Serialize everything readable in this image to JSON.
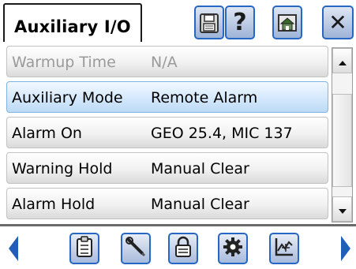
{
  "header": {
    "title": "Auxiliary I/O",
    "buttons": [
      {
        "icon": "save-icon"
      },
      {
        "icon": "help-icon",
        "glyph": "?"
      },
      {
        "icon": "home-icon"
      },
      {
        "icon": "close-icon",
        "glyph": "✕"
      }
    ]
  },
  "rows": [
    {
      "name": "Warmup Time",
      "value": "N/A",
      "state": "disabled"
    },
    {
      "name": "Auxiliary Mode",
      "value": "Remote Alarm",
      "state": "selected"
    },
    {
      "name": "Alarm On",
      "value": "GEO 25.4, MIC 137",
      "state": "normal"
    },
    {
      "name": "Warning Hold",
      "value": "Manual Clear",
      "state": "normal"
    },
    {
      "name": "Alarm Hold",
      "value": "Manual Clear",
      "state": "normal"
    }
  ],
  "scrollbar": {
    "up_icon": "arrow-up-icon",
    "down_icon": "arrow-down-icon"
  },
  "bottom_nav": {
    "left_icon": "chevron-left-icon",
    "right_icon": "chevron-right-icon",
    "buttons": [
      "clipboard-icon",
      "wrench-icon",
      "lock-icon",
      "gear-icon",
      "chart-icon"
    ]
  },
  "colors": {
    "accent": "#2767c4",
    "selected_row": "#cfe5fb",
    "disabled_text": "#9a9a9a"
  }
}
